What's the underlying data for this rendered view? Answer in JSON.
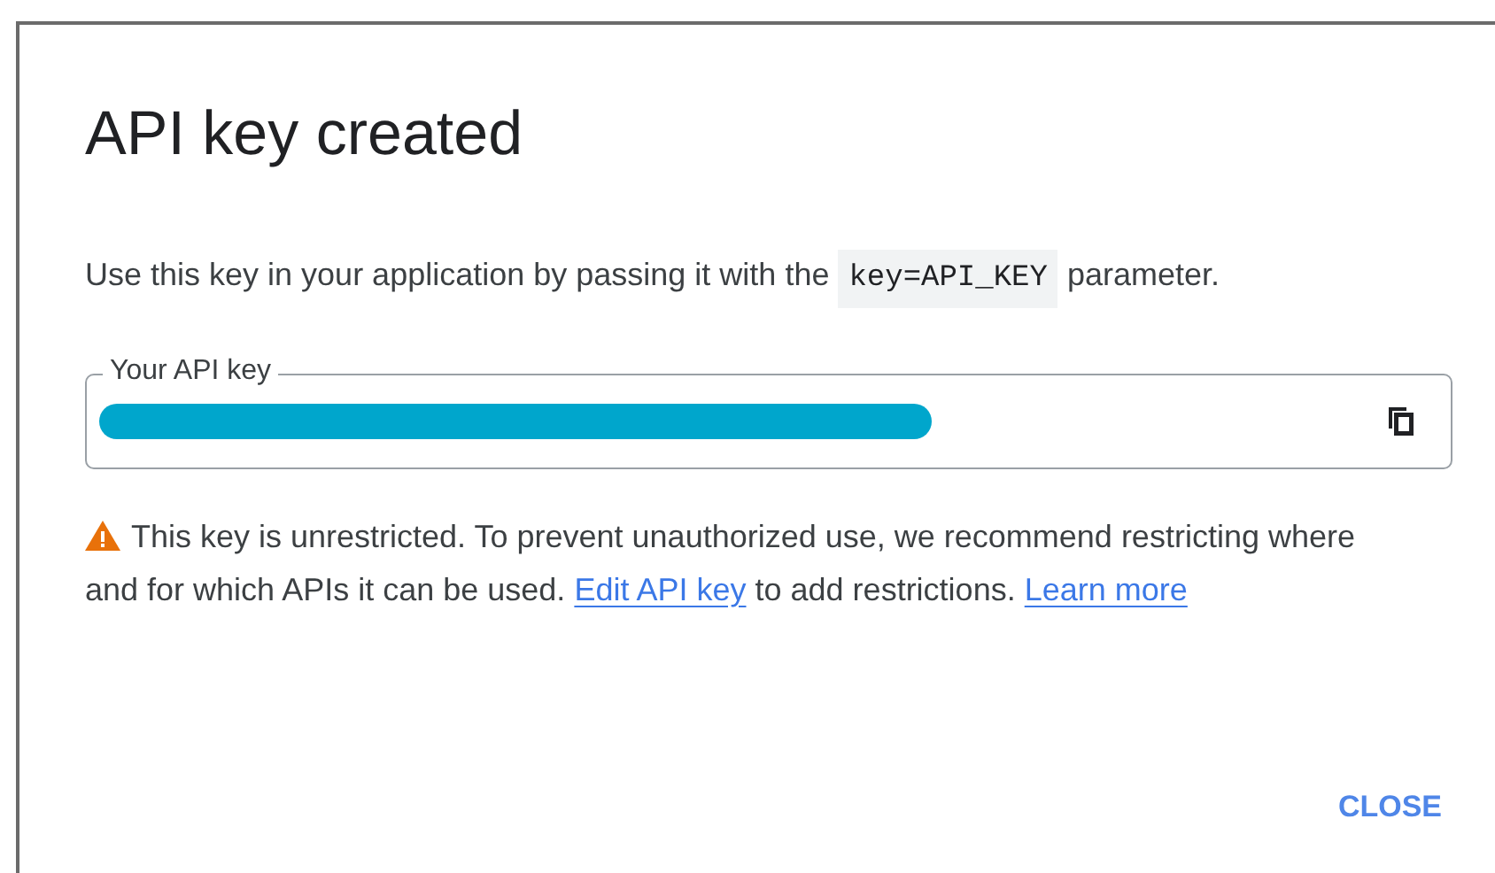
{
  "dialog": {
    "title": "API key created",
    "description": {
      "before": "Use this key in your application by passing it with the",
      "code": "key=API_KEY",
      "after": "parameter."
    },
    "key_field": {
      "label": "Your API key"
    },
    "warning": {
      "parts": [
        {
          "kind": "text",
          "text": "This key is unrestricted. To prevent unauthorized use, we recommend restricting where and for which APIs it can be used."
        },
        {
          "kind": "link",
          "text": "Edit API key"
        },
        {
          "kind": "text",
          "text": "to add restrictions."
        },
        {
          "kind": "link",
          "text": "Learn more"
        }
      ]
    },
    "buttons": [
      "CLOSE"
    ]
  }
}
